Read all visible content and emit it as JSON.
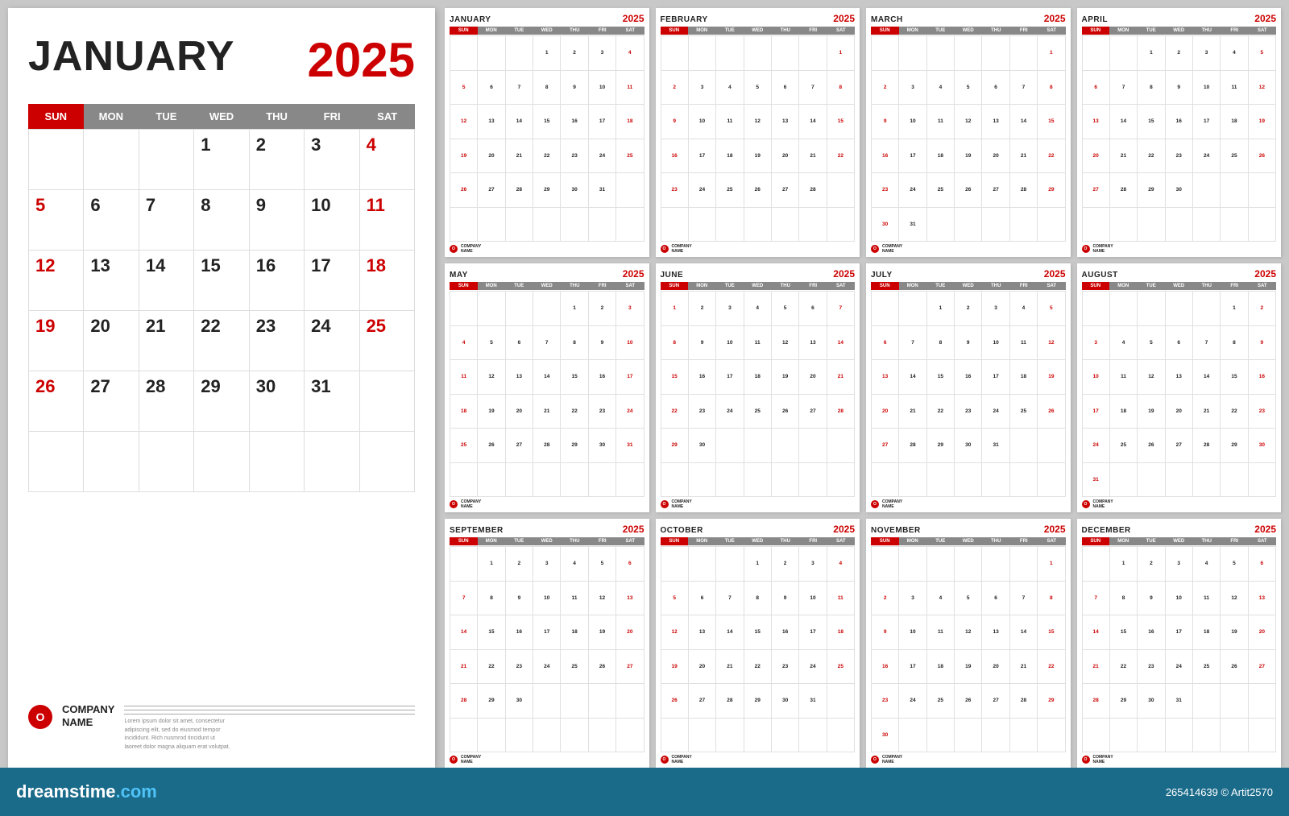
{
  "page": {
    "background": "#c8c8c8"
  },
  "dreamstime": {
    "logo": "dreamstime",
    "logo_com": ".com",
    "info": "265414639 © Artit2570"
  },
  "large_calendar": {
    "month": "JANUARY",
    "year": "2025",
    "days_header": [
      "SUN",
      "MON",
      "TUE",
      "WED",
      "THU",
      "FRI",
      "SAT"
    ],
    "company_name": "COMPANY\nNAME",
    "company_desc": "Lorem ipsum dolor sit amet, consectetur adipiscing elit, sed do eiusmod tempor incididunt\neiusmod tempor incididunt. Rich\nnusmrod tincidunt ut laoreet dolor magna\naliquam erat volutpat."
  },
  "months": [
    {
      "name": "JANUARY",
      "year": "2025",
      "days": [
        "",
        "",
        "",
        "1",
        "2",
        "3",
        "4",
        "5",
        "6",
        "7",
        "8",
        "9",
        "10",
        "11",
        "12",
        "13",
        "14",
        "15",
        "16",
        "17",
        "18",
        "19",
        "20",
        "21",
        "22",
        "23",
        "24",
        "25",
        "26",
        "27",
        "28",
        "29",
        "30",
        "31",
        "",
        "",
        "",
        "",
        "",
        "",
        "",
        ""
      ],
      "red_days": [
        "4",
        "11",
        "18",
        "25",
        "5",
        "12",
        "19",
        "26"
      ]
    },
    {
      "name": "FEBRUARY",
      "year": "2025",
      "days": [
        "",
        "",
        "",
        "",
        "",
        "",
        "1",
        "2",
        "3",
        "4",
        "5",
        "6",
        "7",
        "8",
        "9",
        "10",
        "11",
        "12",
        "13",
        "14",
        "15",
        "16",
        "17",
        "18",
        "19",
        "20",
        "21",
        "22",
        "23",
        "24",
        "25",
        "26",
        "27",
        "28",
        "",
        "",
        "",
        "",
        "",
        "",
        ""
      ],
      "red_days": [
        "1",
        "8",
        "15",
        "22",
        "2",
        "9",
        "16",
        "23"
      ]
    },
    {
      "name": "MARCH",
      "year": "2025",
      "days": [
        "",
        "",
        "",
        "",
        "",
        "",
        "1",
        "2",
        "3",
        "4",
        "5",
        "6",
        "7",
        "8",
        "9",
        "10",
        "11",
        "12",
        "13",
        "14",
        "15",
        "16",
        "17",
        "18",
        "19",
        "20",
        "21",
        "22",
        "23",
        "24",
        "25",
        "26",
        "27",
        "28",
        "29",
        "30",
        "31",
        "",
        "",
        "",
        "",
        ""
      ],
      "red_days": [
        "1",
        "8",
        "15",
        "22",
        "29",
        "2",
        "9",
        "16",
        "23",
        "30"
      ]
    },
    {
      "name": "APRIL",
      "year": "2025",
      "days": [
        "",
        "",
        "1",
        "2",
        "3",
        "4",
        "5",
        "6",
        "7",
        "8",
        "9",
        "10",
        "11",
        "12",
        "13",
        "14",
        "15",
        "16",
        "17",
        "18",
        "19",
        "20",
        "21",
        "22",
        "23",
        "24",
        "25",
        "26",
        "27",
        "28",
        "29",
        "30",
        "",
        "",
        "",
        "",
        "",
        "",
        "",
        ""
      ],
      "red_days": [
        "5",
        "12",
        "19",
        "26",
        "6",
        "13",
        "20",
        "27"
      ]
    },
    {
      "name": "MAY",
      "year": "2025",
      "days": [
        "",
        "",
        "",
        "",
        "1",
        "2",
        "3",
        "4",
        "5",
        "6",
        "7",
        "8",
        "9",
        "10",
        "11",
        "12",
        "13",
        "14",
        "15",
        "16",
        "17",
        "18",
        "19",
        "20",
        "21",
        "22",
        "23",
        "24",
        "25",
        "26",
        "27",
        "28",
        "29",
        "30",
        "31",
        "",
        "",
        "",
        "",
        "",
        ""
      ],
      "red_days": [
        "3",
        "10",
        "17",
        "24",
        "31",
        "4",
        "11",
        "18",
        "25"
      ]
    },
    {
      "name": "JUNE",
      "year": "2025",
      "days": [
        "1",
        "2",
        "3",
        "4",
        "5",
        "6",
        "7",
        "8",
        "9",
        "10",
        "11",
        "12",
        "13",
        "14",
        "15",
        "16",
        "17",
        "18",
        "19",
        "20",
        "21",
        "22",
        "23",
        "24",
        "25",
        "26",
        "27",
        "28",
        "29",
        "30",
        "",
        "",
        "",
        "",
        "",
        "",
        "",
        "",
        "",
        ""
      ],
      "red_days": [
        "1",
        "8",
        "15",
        "22",
        "29",
        "7",
        "14",
        "21",
        "28"
      ]
    },
    {
      "name": "JULY",
      "year": "2025",
      "days": [
        "",
        "",
        "1",
        "2",
        "3",
        "4",
        "5",
        "6",
        "7",
        "8",
        "9",
        "10",
        "11",
        "12",
        "13",
        "14",
        "15",
        "16",
        "17",
        "18",
        "19",
        "20",
        "21",
        "22",
        "23",
        "24",
        "25",
        "26",
        "27",
        "28",
        "29",
        "30",
        "31",
        "",
        "",
        "",
        "",
        "",
        "",
        "",
        ""
      ],
      "red_days": [
        "5",
        "12",
        "19",
        "26",
        "6",
        "13",
        "20",
        "27"
      ]
    },
    {
      "name": "AUGUST",
      "year": "2025",
      "days": [
        "",
        "",
        "",
        "",
        "",
        "1",
        "2",
        "3",
        "4",
        "5",
        "6",
        "7",
        "8",
        "9",
        "10",
        "11",
        "12",
        "13",
        "14",
        "15",
        "16",
        "17",
        "18",
        "19",
        "20",
        "21",
        "22",
        "23",
        "24",
        "25",
        "26",
        "27",
        "28",
        "29",
        "30",
        "31",
        "",
        "",
        "",
        "",
        ""
      ],
      "red_days": [
        "2",
        "9",
        "16",
        "23",
        "30",
        "3",
        "10",
        "17",
        "24",
        "31"
      ]
    },
    {
      "name": "SEPTEMBER",
      "year": "2025",
      "days": [
        "",
        "1",
        "2",
        "3",
        "4",
        "5",
        "6",
        "7",
        "8",
        "9",
        "10",
        "11",
        "12",
        "13",
        "14",
        "15",
        "16",
        "17",
        "18",
        "19",
        "20",
        "21",
        "22",
        "23",
        "24",
        "25",
        "26",
        "27",
        "28",
        "29",
        "30",
        "",
        "",
        "",
        "",
        "",
        "",
        "",
        "",
        "",
        ""
      ],
      "red_days": [
        "6",
        "13",
        "20",
        "27",
        "7",
        "14",
        "21",
        "28"
      ]
    },
    {
      "name": "OCTOBER",
      "year": "2025",
      "days": [
        "",
        "",
        "1",
        "2",
        "3",
        "4",
        "5",
        "6",
        "7",
        "8",
        "9",
        "10",
        "11",
        "12",
        "13",
        "14",
        "15",
        "16",
        "17",
        "18",
        "19",
        "20",
        "21",
        "22",
        "23",
        "24",
        "25",
        "26",
        "27",
        "28",
        "29",
        "30",
        "31",
        "",
        "",
        "",
        "",
        "",
        "",
        "",
        ""
      ],
      "red_days": [
        "5",
        "12",
        "19",
        "26",
        "4",
        "11",
        "18",
        "25"
      ]
    },
    {
      "name": "NOVEMBER",
      "year": "2025",
      "days": [
        "",
        "",
        "",
        "",
        "",
        "",
        "1",
        "2",
        "3",
        "4",
        "5",
        "6",
        "7",
        "8",
        "9",
        "10",
        "11",
        "12",
        "13",
        "14",
        "15",
        "16",
        "17",
        "18",
        "19",
        "20",
        "21",
        "22",
        "23",
        "24",
        "25",
        "26",
        "27",
        "28",
        "29",
        "30",
        "",
        "",
        "",
        "",
        "",
        ""
      ],
      "red_days": [
        "1",
        "8",
        "15",
        "22",
        "29",
        "2",
        "9",
        "16",
        "23",
        "30"
      ]
    },
    {
      "name": "DECEMBER",
      "year": "2025",
      "days": [
        "",
        "1",
        "2",
        "3",
        "4",
        "5",
        "6",
        "7",
        "8",
        "9",
        "10",
        "11",
        "12",
        "13",
        "14",
        "15",
        "16",
        "17",
        "18",
        "19",
        "20",
        "21",
        "22",
        "23",
        "24",
        "25",
        "26",
        "27",
        "28",
        "29",
        "30",
        "31",
        "",
        "",
        "",
        "",
        "",
        "",
        "",
        "",
        "",
        ""
      ],
      "red_days": [
        "6",
        "13",
        "20",
        "27",
        "7",
        "14",
        "21",
        "28"
      ]
    }
  ]
}
